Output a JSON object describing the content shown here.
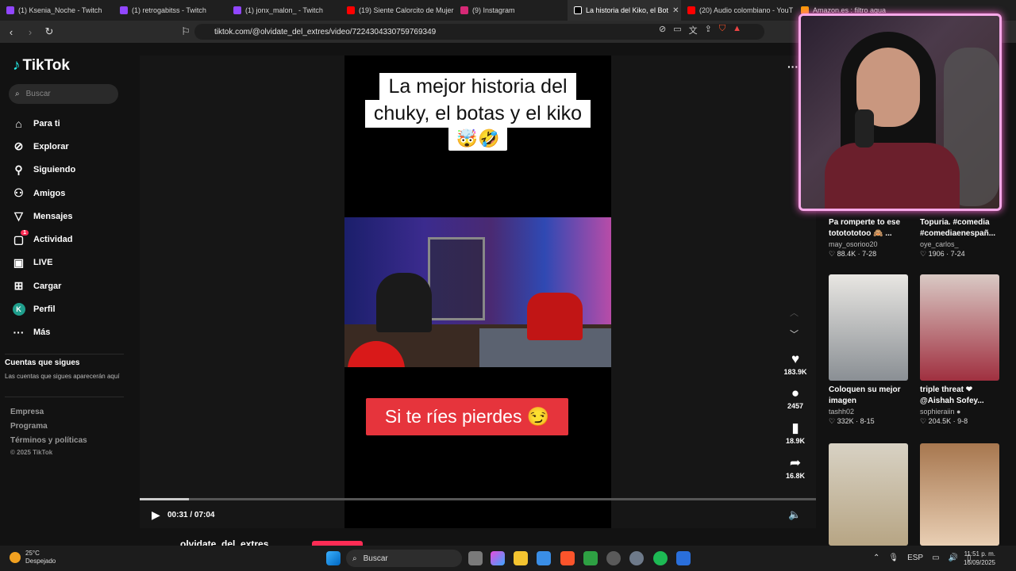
{
  "browser": {
    "tabs": [
      {
        "label": "(1) Ksenia_Noche - Twitch",
        "color": "#9146ff"
      },
      {
        "label": "(1) retrogabitss - Twitch",
        "color": "#9146ff"
      },
      {
        "label": "(1) jonx_malon_ - Twitch",
        "color": "#9146ff"
      },
      {
        "label": "(19) Siente Calorcito de Mujer",
        "color": "#ff0000"
      },
      {
        "label": "(9) Instagram",
        "color": "#d62976"
      },
      {
        "label": "La historia del Kiko, el Bot",
        "color": "#000000"
      },
      {
        "label": "(20) Audio colombiano - YouT",
        "color": "#ff0000"
      },
      {
        "label": "Amazon.es : filtro agua",
        "color": "#ff9900"
      }
    ],
    "active_tab_close": "✕",
    "url": "tiktok.com/@olvidate_del_extres/video/7224304330759769349"
  },
  "sidebar": {
    "logo": "TikTok",
    "search_placeholder": "Buscar",
    "nav": [
      {
        "label": "Para ti",
        "icon": "home-icon"
      },
      {
        "label": "Explorar",
        "icon": "compass-icon"
      },
      {
        "label": "Siguiendo",
        "icon": "following-icon"
      },
      {
        "label": "Amigos",
        "icon": "friends-icon"
      },
      {
        "label": "Mensajes",
        "icon": "messages-icon"
      },
      {
        "label": "Actividad",
        "icon": "activity-icon",
        "badge": "1"
      },
      {
        "label": "LIVE",
        "icon": "live-icon"
      },
      {
        "label": "Cargar",
        "icon": "upload-icon"
      },
      {
        "label": "Perfil",
        "icon": "avatar",
        "avatar_letter": "K"
      },
      {
        "label": "Más",
        "icon": "more-icon"
      }
    ],
    "following_title": "Cuentas que sigues",
    "following_subtitle": "Las cuentas que sigues aparecerán aquí",
    "footer": [
      "Empresa",
      "Programa",
      "Términos y políticas"
    ],
    "copyright": "© 2025 TikTok"
  },
  "video": {
    "caption_lines": [
      "La mejor historia del",
      "chuky, el botas y el kiko"
    ],
    "caption_emoji": "🤯🤣",
    "red_caption": "Si te ríes pierdes",
    "red_caption_emoji": "😏",
    "timecode": "00:31 / 07:04",
    "progress": 0.073,
    "author": "olvidate_del_extres"
  },
  "actions": [
    {
      "icon": "heart-icon",
      "count": "183.9K"
    },
    {
      "icon": "comment-icon",
      "count": "2457"
    },
    {
      "icon": "bookmark-icon",
      "count": "18.9K"
    },
    {
      "icon": "share-icon",
      "count": "16.8K"
    }
  ],
  "recommended": [
    {
      "title": "Pa romperte to ese tototototoo 🙈 ...",
      "user": "may_osorioo20",
      "stats": "♡ 88.4K · 7-28"
    },
    {
      "title": "Topuria. #comedia #comediaenespañ...",
      "user": "oye_carlos_",
      "stats": "♡ 1906 · 7-24"
    },
    {
      "title": "Coloquen su mejor imagen",
      "user": "tashh02",
      "stats": "♡ 332K · 8-15",
      "thumb": "#8a8f94"
    },
    {
      "title": "triple threat ❤ @Aishah Sofey...",
      "user": "sophieraiin ●",
      "stats": "♡ 204.5K · 9-8",
      "thumb": "#a03040"
    },
    {
      "title": "",
      "user": "",
      "stats": "",
      "thumb": "#b7a584"
    },
    {
      "title": "",
      "user": "",
      "stats": "",
      "thumb": "#c2a07a"
    }
  ],
  "taskbar": {
    "temperature": "25°C",
    "weather": "Despejado",
    "search": "Buscar",
    "lang": "ESP",
    "time": "11:51 p. m.",
    "date": "16/09/2025"
  }
}
